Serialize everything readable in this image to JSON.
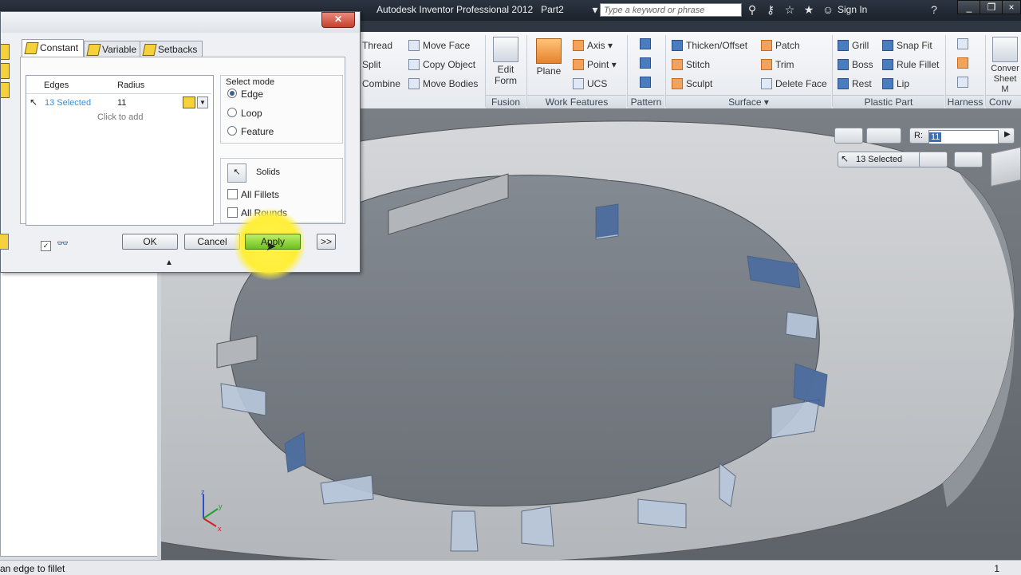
{
  "app": {
    "title": "Autodesk Inventor Professional 2012",
    "document": "Part2",
    "search_placeholder": "Type a keyword or phrase",
    "sign_in": "Sign In"
  },
  "ribbon": {
    "modify_items": [
      "Thread",
      "Split",
      "Combine"
    ],
    "modify2_items": [
      "Move Face",
      "Copy Object",
      "Move Bodies"
    ],
    "fusion": {
      "label": "Fusion",
      "edit_form": "Edit Form"
    },
    "work_features": {
      "label": "Work Features",
      "plane": "Plane",
      "axis": "Axis",
      "point": "Point",
      "ucs": "UCS"
    },
    "pattern": {
      "label": "Pattern"
    },
    "surface": {
      "label": "Surface",
      "items": [
        "Thicken/Offset",
        "Stitch",
        "Sculpt",
        "Patch",
        "Trim",
        "Delete Face"
      ]
    },
    "plastic_part": {
      "label": "Plastic Part",
      "items": [
        "Grill",
        "Boss",
        "Rest",
        "Snap Fit",
        "Rule Fillet",
        "Lip"
      ]
    },
    "harness": {
      "label": "Harness"
    },
    "convert": {
      "label": "Conv",
      "item": "Conver Sheet M"
    }
  },
  "dialog": {
    "tabs": [
      "Constant",
      "Variable",
      "Setbacks"
    ],
    "table_headers": {
      "edges": "Edges",
      "radius": "Radius"
    },
    "rows": [
      {
        "edges": "13 Selected",
        "radius": "11"
      }
    ],
    "click_to_add": "Click to add",
    "select_mode": {
      "label": "Select mode",
      "options": [
        "Edge",
        "Loop",
        "Feature"
      ],
      "selected": "Edge"
    },
    "solids": "Solids",
    "checkboxes": [
      "All Fillets",
      "All Rounds"
    ],
    "buttons": {
      "ok": "OK",
      "cancel": "Cancel",
      "apply": "Apply",
      "more": ">>"
    }
  },
  "viewport": {
    "radius_label": "R:",
    "radius_value": "11",
    "selection": "13 Selected"
  },
  "status": {
    "text": "an edge to fillet",
    "count": "1"
  }
}
